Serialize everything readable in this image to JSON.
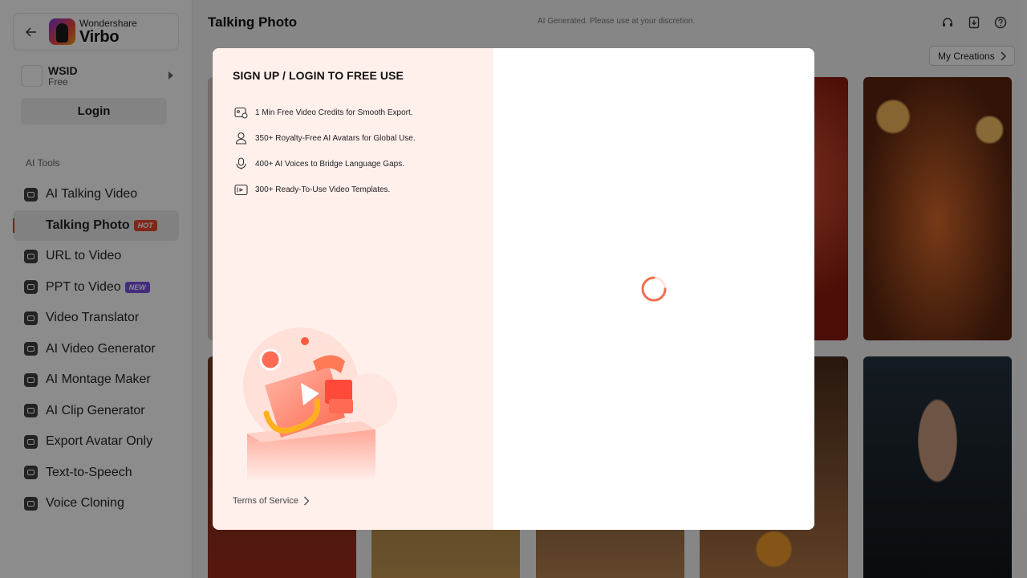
{
  "brand": {
    "top": "Wondershare",
    "name": "Virbo"
  },
  "user": {
    "name": "WSID",
    "plan": "Free",
    "login_label": "Login"
  },
  "sidebar": {
    "section_label": "AI Tools",
    "items": [
      {
        "label": "AI Talking Video",
        "icon": "talking-video-icon"
      },
      {
        "label": "Talking Photo",
        "icon": "talking-photo-icon",
        "badge": "HOT",
        "active": true
      },
      {
        "label": "URL to Video",
        "icon": "url-icon"
      },
      {
        "label": "PPT to Video",
        "icon": "ppt-icon",
        "badge": "NEW"
      },
      {
        "label": "Video Translator",
        "icon": "translate-icon"
      },
      {
        "label": "AI Video Generator",
        "icon": "video-generator-icon"
      },
      {
        "label": "AI Montage Maker",
        "icon": "montage-icon"
      },
      {
        "label": "AI Clip Generator",
        "icon": "clip-icon"
      },
      {
        "label": "Export Avatar Only",
        "icon": "avatar-export-icon"
      },
      {
        "label": "Text-to-Speech",
        "icon": "tts-icon"
      },
      {
        "label": "Voice Cloning",
        "icon": "voice-clone-icon"
      }
    ]
  },
  "header": {
    "title": "Talking Photo",
    "disclaimer": "AI Generated. Please use at your discretion.",
    "my_creations": "My Creations"
  },
  "modal": {
    "title": "SIGN UP / LOGIN TO FREE USE",
    "benefits": [
      {
        "text": "1 Min Free Video Credits for Smooth Export.",
        "icon": "video-credits-icon"
      },
      {
        "text": "350+ Royalty-Free AI Avatars for Global Use.",
        "icon": "avatar-icon"
      },
      {
        "text": "400+ AI Voices to Bridge Language Gaps.",
        "icon": "microphone-icon"
      },
      {
        "text": "300+ Ready-To-Use Video Templates.",
        "icon": "template-icon"
      }
    ],
    "terms": "Terms of Service"
  },
  "colors": {
    "accent": "#e8492f",
    "new_badge": "#7b4fe6",
    "modal_left_bg": "#fff0ec"
  }
}
